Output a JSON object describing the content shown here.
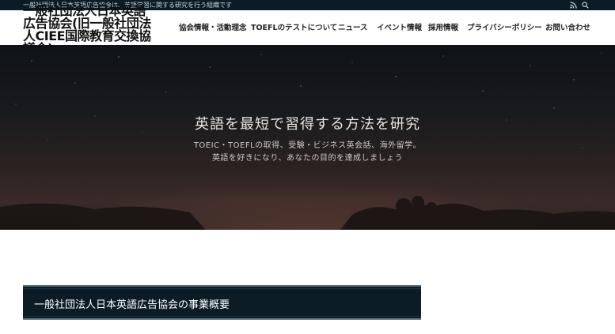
{
  "topbar": {
    "tagline": "一般社団法人日本英語広告協会は、英語学習に関する研究を行う組織です",
    "rss_icon": "rss-icon",
    "search_icon": "search-icon"
  },
  "site": {
    "title": "一般社団法人日本英語広告協会(旧一般社団法人CIEE国際教育交換協議会)"
  },
  "nav": {
    "items": [
      {
        "label": "協会情報・活動理念"
      },
      {
        "label": "TOEFLのテストについて"
      },
      {
        "label": "ニュース"
      },
      {
        "label": "イベント情報"
      },
      {
        "label": "採用情報"
      },
      {
        "label": "プライバシーポリシー"
      },
      {
        "label": "お問い合わせ"
      }
    ]
  },
  "hero": {
    "title": "英語を最短で習得する方法を研究",
    "subtitle_line1": "TOEIC・TOEFLの取得、受験・ビジネス英会話、海外留学。",
    "subtitle_line2": "英語を好きになり、あなたの目的を達成しましょう"
  },
  "section": {
    "title": "一般社団法人日本英語広告協会の事業概要"
  },
  "colors": {
    "topbar_bg": "#0b1c27",
    "section_bar_bg": "#0b1c27",
    "hero_text": "#e9e6e2"
  }
}
